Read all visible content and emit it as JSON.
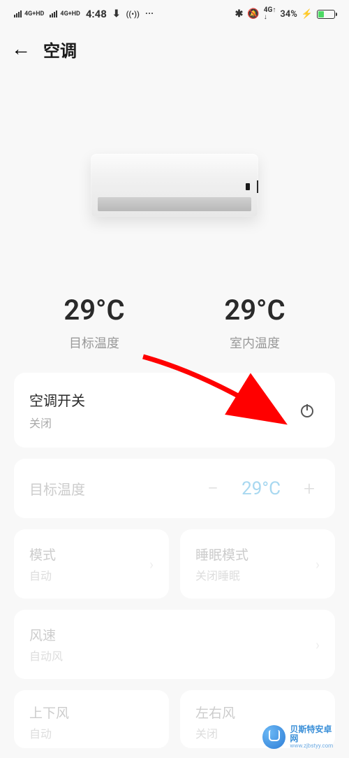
{
  "status_bar": {
    "net_label": "4G+HD",
    "time": "4:48",
    "battery": "34%"
  },
  "header": {
    "title": "空调"
  },
  "temps": {
    "target": {
      "value": "29°C",
      "label": "目标温度"
    },
    "room": {
      "value": "29°C",
      "label": "室内温度"
    }
  },
  "power": {
    "title": "空调开关",
    "state": "关闭"
  },
  "temp_set": {
    "label": "目标温度",
    "value": "29°C"
  },
  "mode": {
    "title": "模式",
    "sub": "自动"
  },
  "sleep": {
    "title": "睡眠模式",
    "sub": "关闭睡眠"
  },
  "wind": {
    "title": "风速",
    "sub": "自动风"
  },
  "vswing": {
    "title": "上下风",
    "sub": "自动"
  },
  "hswing": {
    "title": "左右风",
    "sub": "关闭"
  },
  "watermark": {
    "cn": "贝斯特安卓网",
    "url": "www.zjbstyy.com"
  }
}
